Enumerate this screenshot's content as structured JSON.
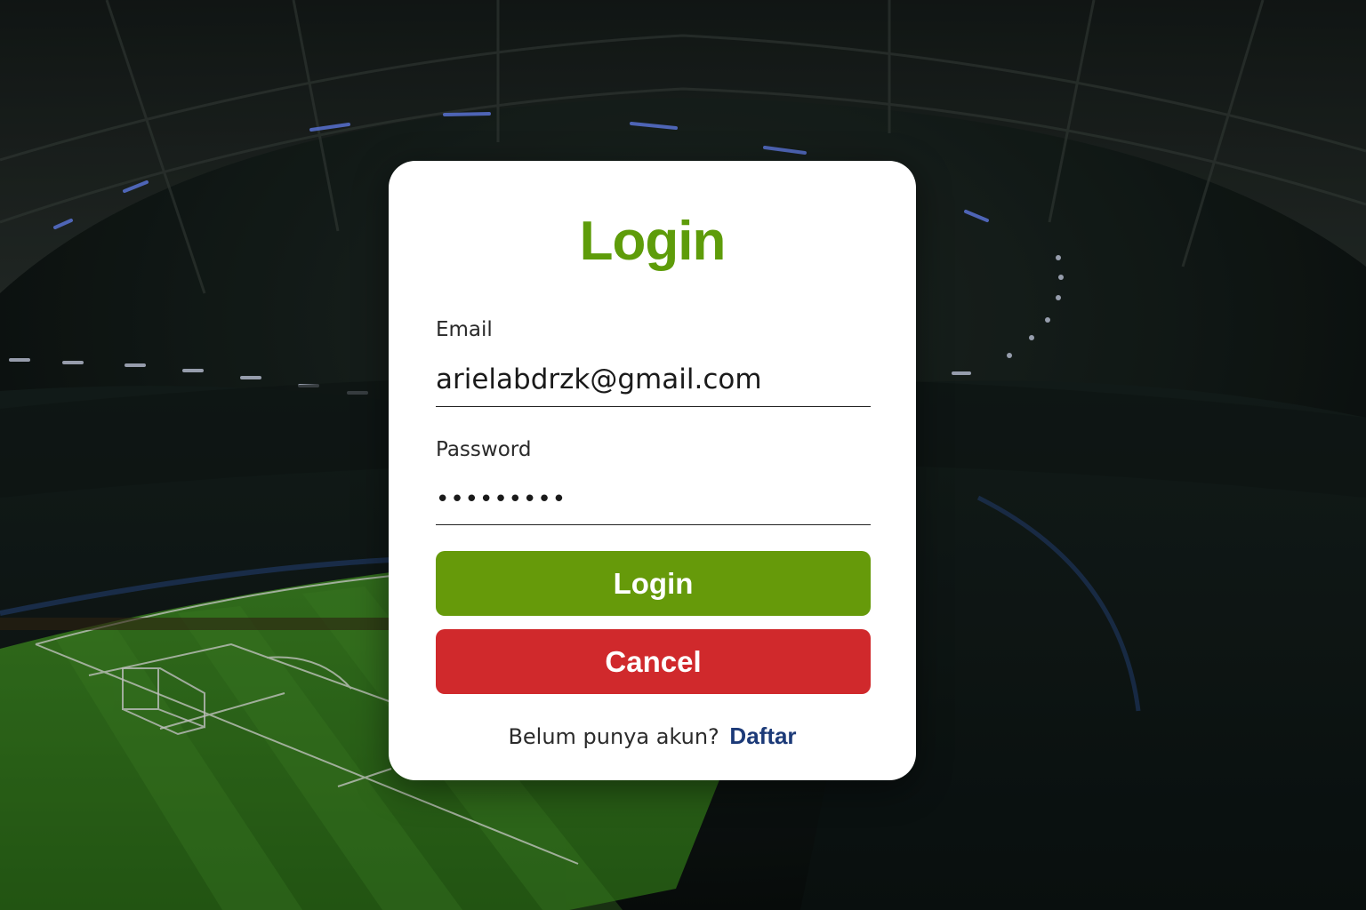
{
  "login_card": {
    "title": "Login",
    "email_label": "Email",
    "email_value": "arielabdrzk@gmail.com",
    "password_label": "Password",
    "password_value": "•••••••••",
    "login_button": "Login",
    "cancel_button": "Cancel",
    "signup_prompt": "Belum punya akun?",
    "signup_link": "Daftar"
  },
  "colors": {
    "title": "#5e9c0a",
    "login_button": "#669a0a",
    "cancel_button": "#d0292c",
    "signup_link": "#1c3a78"
  }
}
